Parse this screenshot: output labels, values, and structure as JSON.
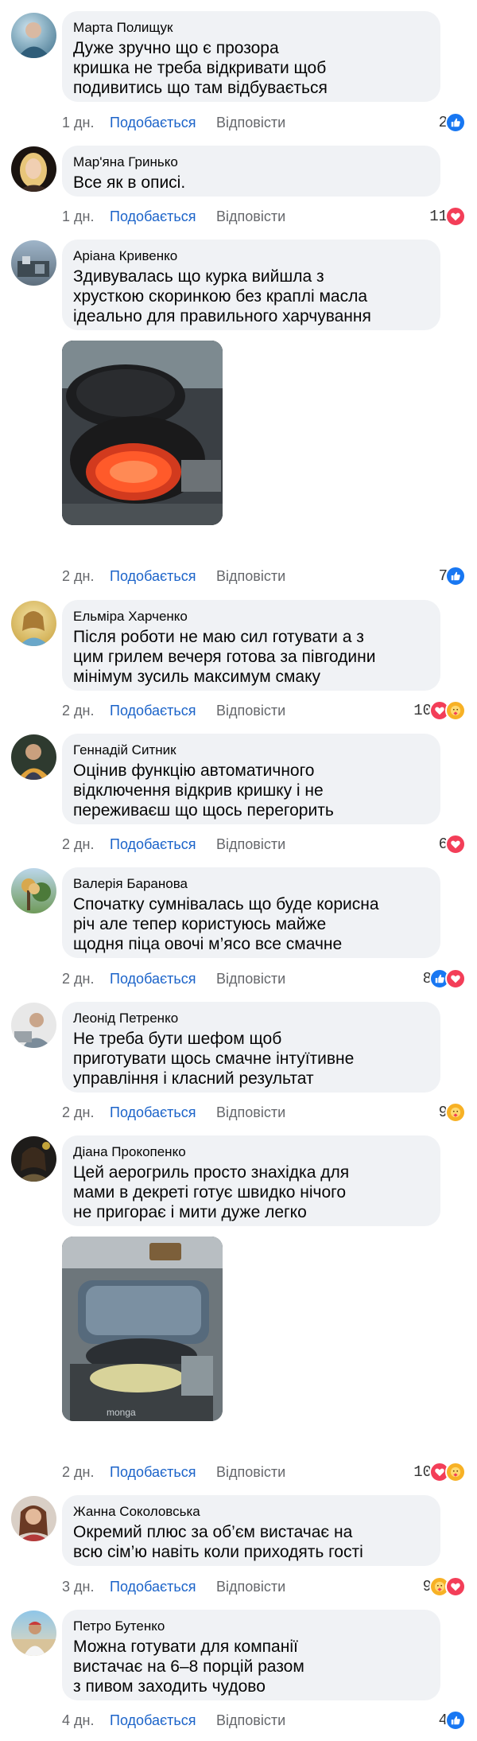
{
  "comments": [
    {
      "author": "Марта Полищук",
      "text": "Дуже зручно що є прозора\nкришка не треба відкривати щоб\nподивитись що там відбувається",
      "time": "1 дн.",
      "like": "Подобається",
      "reply": "Відповісти",
      "count": "2",
      "reactions": [
        "like"
      ]
    },
    {
      "author": "Мар'яна Гринько",
      "text": "Все як в описі.",
      "time": "1 дн.",
      "like": "Подобається",
      "reply": "Відповісти",
      "count": "11",
      "reactions": [
        "love"
      ]
    },
    {
      "author": "Аріана Кривенко",
      "text": "Здивувалась що курка вийшла з\nхрусткою скоринкою без краплі масла\nідеально для правильного харчування",
      "time": "2 дн.",
      "like": "Подобається",
      "reply": "Відповісти",
      "count": "7",
      "reactions": [
        "like"
      ],
      "photo": "air-fryer-heating"
    },
    {
      "author": "Ельміра Харченко",
      "text": "Після роботи не маю сил готувати а з\nцим грилем вечеря готова за півгодини\nмінімум зусиль максимум смаку",
      "time": "2 дн.",
      "like": "Подобається",
      "reply": "Відповісти",
      "count": "10",
      "reactions": [
        "love",
        "care"
      ]
    },
    {
      "author": "Геннадій Ситник",
      "text": "Оцінив функцію автоматичного\nвідключення відкрив кришку і не\nпереживаєш що щось перегорить",
      "time": "2 дн.",
      "like": "Подобається",
      "reply": "Відповісти",
      "count": "6",
      "reactions": [
        "love"
      ]
    },
    {
      "author": "Валерія Баранова",
      "text": "Спочатку сумнівалась що буде корисна\nріч але тепер користуюсь майже\nщодня піца овочі м’ясо все смачне",
      "time": "2 дн.",
      "like": "Подобається",
      "reply": "Відповісти",
      "count": "8",
      "reactions": [
        "like",
        "love"
      ]
    },
    {
      "author": "Леонід Петренко",
      "text": "Не треба бути шефом щоб\nприготувати щось смачне інтуїтивне\nуправління і класний результат",
      "time": "2 дн.",
      "like": "Подобається",
      "reply": "Відповісти",
      "count": "9",
      "reactions": [
        "care"
      ]
    },
    {
      "author": "Діана Прокопенко",
      "text": "Цей аерогриль просто знахідка для\nмами в декреті готує швидко нічого\nне пригорає і мити дуже легко",
      "time": "2 дн.",
      "like": "Подобається",
      "reply": "Відповісти",
      "count": "10",
      "reactions": [
        "love",
        "care"
      ],
      "photo": "air-fryer-monga"
    },
    {
      "author": "Жанна Соколовська",
      "text": "Окремий плюс за об’єм вистачає на\nвсю сім’ю навіть коли приходять гості",
      "time": "3 дн.",
      "like": "Подобається",
      "reply": "Відповісти",
      "count": "9",
      "reactions": [
        "care",
        "love"
      ]
    },
    {
      "author": "Петро Бутенко",
      "text": "Можна готувати для компанії\nвистачає на 6–8 порцій разом\nз пивом заходить чудово",
      "time": "4 дн.",
      "like": "Подобається",
      "reply": "Відповісти",
      "count": "4",
      "reactions": [
        "like"
      ]
    }
  ],
  "photo_brand": "monga"
}
